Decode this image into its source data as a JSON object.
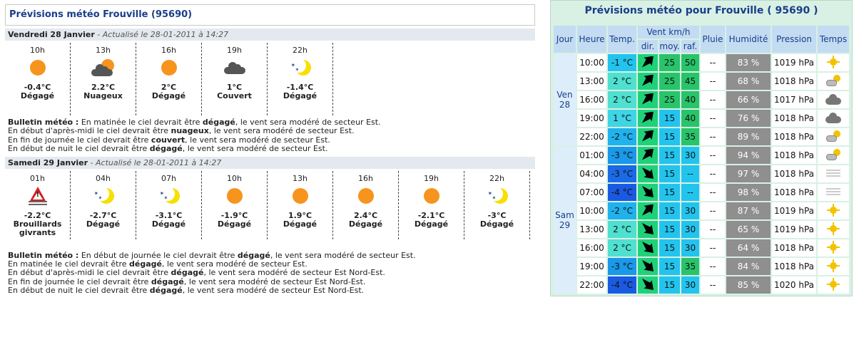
{
  "left": {
    "title": "Prévisions météo Frouville (95690)",
    "days": [
      {
        "name": "Vendredi 28 Janvier",
        "updated": "- Actualisé le 28-01-2011 à 14:27",
        "hours": [
          {
            "h": "10h",
            "icon": "sun-icon",
            "temp": "-0.4°C",
            "cond": "Dégagé"
          },
          {
            "h": "13h",
            "icon": "partly-cloudy-icon",
            "temp": "2.2°C",
            "cond": "Nuageux"
          },
          {
            "h": "16h",
            "icon": "sun-icon",
            "temp": "2°C",
            "cond": "Dégagé"
          },
          {
            "h": "19h",
            "icon": "cloud-icon",
            "temp": "1°C",
            "cond": "Couvert"
          },
          {
            "h": "22h",
            "icon": "moon-icon",
            "temp": "-1.4°C",
            "cond": "Dégagé"
          }
        ],
        "bulletin_label": "Bulletin météo :",
        "bulletin": [
          {
            "a": "En matinée le ciel devrait être ",
            "b": "dégagé",
            "c": ", le vent sera modéré de secteur Est."
          },
          {
            "a": "En début d'après-midi le ciel devrait être ",
            "b": "nuageux",
            "c": ", le vent sera modéré de secteur Est."
          },
          {
            "a": "En fin de journée le ciel devrait être ",
            "b": "couvert",
            "c": ", le vent sera modéré de secteur Est."
          },
          {
            "a": "En début de nuit le ciel devrait être ",
            "b": "dégagé",
            "c": ", le vent sera modéré de secteur Est."
          }
        ]
      },
      {
        "name": "Samedi 29 Janvier",
        "updated": "- Actualisé le 28-01-2011 à 14:27",
        "hours": [
          {
            "h": "01h",
            "icon": "fog-warning-icon",
            "temp": "-2.2°C",
            "cond": "Brouillards",
            "cond2": "givrants"
          },
          {
            "h": "04h",
            "icon": "moon-icon",
            "temp": "-2.7°C",
            "cond": "Dégagé"
          },
          {
            "h": "07h",
            "icon": "moon-icon",
            "temp": "-3.1°C",
            "cond": "Dégagé"
          },
          {
            "h": "10h",
            "icon": "sun-icon",
            "temp": "-1.9°C",
            "cond": "Dégagé"
          },
          {
            "h": "13h",
            "icon": "sun-icon",
            "temp": "1.9°C",
            "cond": "Dégagé"
          },
          {
            "h": "16h",
            "icon": "sun-icon",
            "temp": "2.4°C",
            "cond": "Dégagé"
          },
          {
            "h": "19h",
            "icon": "sun-icon",
            "temp": "-2.1°C",
            "cond": "Dégagé"
          },
          {
            "h": "22h",
            "icon": "moon-icon",
            "temp": "-3°C",
            "cond": "Dégagé"
          }
        ],
        "bulletin_label": "Bulletin météo :",
        "bulletin": [
          {
            "a": "En début de journée le ciel devrait être ",
            "b": "dégagé",
            "c": ", le vent sera modéré de secteur Est."
          },
          {
            "a": "En matinée le ciel devrait être ",
            "b": "dégagé",
            "c": ", le vent sera modéré de secteur Est."
          },
          {
            "a": "En début d'après-midi le ciel devrait être ",
            "b": "dégagé",
            "c": ", le vent sera modéré de secteur Est Nord-Est."
          },
          {
            "a": "En fin de journée le ciel devrait être ",
            "b": "dégagé",
            "c": ", le vent sera modéré de secteur Est Nord-Est."
          },
          {
            "a": "En début de nuit le ciel devrait être ",
            "b": "dégagé",
            "c": ", le vent sera modéré de secteur Est Nord-Est."
          }
        ]
      }
    ]
  },
  "right": {
    "title": "Prévisions météo pour Frouville ( 95690 )",
    "headers": {
      "jour": "Jour",
      "heure": "Heure",
      "temp": "Temp.",
      "vent": "Vent km/h",
      "dir": "dir.",
      "moy": "moy.",
      "raf": "raf.",
      "pluie": "Pluie",
      "humidite": "Humidité",
      "pression": "Pression",
      "temps": "Temps"
    },
    "groups": [
      {
        "day": "Ven",
        "date": "28",
        "rows": [
          {
            "heure": "10:00",
            "temp": "-1 °C",
            "temp_color": "#22c4ee",
            "dir": "arrow-ne",
            "moy": "25",
            "moy_color": "#28c46a",
            "raf": "50",
            "raf_color": "#28c46a",
            "pluie": "--",
            "hum": "83 %",
            "pres": "1019 hPa",
            "temps": "sun-icon"
          },
          {
            "heure": "13:00",
            "temp": "2 °C",
            "temp_color": "#4fe0d0",
            "dir": "arrow-ne",
            "moy": "25",
            "moy_color": "#28c46a",
            "raf": "45",
            "raf_color": "#28c46a",
            "pluie": "--",
            "hum": "68 %",
            "pres": "1018 hPa",
            "temps": "partly-cloudy-icon"
          },
          {
            "heure": "16:00",
            "temp": "2 °C",
            "temp_color": "#4fe0d0",
            "dir": "arrow-ne",
            "moy": "25",
            "moy_color": "#28c46a",
            "raf": "40",
            "raf_color": "#28c46a",
            "pluie": "--",
            "hum": "66 %",
            "pres": "1017 hPa",
            "temps": "cloud-icon"
          },
          {
            "heure": "19:00",
            "temp": "1 °C",
            "temp_color": "#3fd4e6",
            "dir": "arrow-ne",
            "moy": "15",
            "moy_color": "#22c4ee",
            "raf": "40",
            "raf_color": "#28c46a",
            "pluie": "--",
            "hum": "76 %",
            "pres": "1018 hPa",
            "temps": "cloud-icon"
          },
          {
            "heure": "22:00",
            "temp": "-2 °C",
            "temp_color": "#1fb2ec",
            "dir": "arrow-ne",
            "moy": "15",
            "moy_color": "#22c4ee",
            "raf": "35",
            "raf_color": "#28c46a",
            "pluie": "--",
            "hum": "89 %",
            "pres": "1018 hPa",
            "temps": "partly-cloudy-icon"
          }
        ]
      },
      {
        "day": "Sam",
        "date": "29",
        "rows": [
          {
            "heure": "01:00",
            "temp": "-3 °C",
            "temp_color": "#1a98ea",
            "dir": "arrow-ne",
            "moy": "15",
            "moy_color": "#22c4ee",
            "raf": "30",
            "raf_color": "#22c4ee",
            "pluie": "--",
            "hum": "94 %",
            "pres": "1018 hPa",
            "temps": "partly-cloudy-icon"
          },
          {
            "heure": "04:00",
            "temp": "-3 °C",
            "temp_color": "#1a6ae6",
            "dir": "arrow-se",
            "moy": "15",
            "moy_color": "#22c4ee",
            "raf": "--",
            "raf_color": "#22c4ee",
            "pluie": "--",
            "hum": "97 %",
            "pres": "1018 hPa",
            "temps": "fog-icon"
          },
          {
            "heure": "07:00",
            "temp": "-4 °C",
            "temp_color": "#1a5ae2",
            "dir": "arrow-se",
            "moy": "15",
            "moy_color": "#22c4ee",
            "raf": "--",
            "raf_color": "#22c4ee",
            "pluie": "--",
            "hum": "98 %",
            "pres": "1018 hPa",
            "temps": "fog-icon"
          },
          {
            "heure": "10:00",
            "temp": "-2 °C",
            "temp_color": "#1fb2ec",
            "dir": "arrow-ne",
            "moy": "15",
            "moy_color": "#22c4ee",
            "raf": "30",
            "raf_color": "#22c4ee",
            "pluie": "--",
            "hum": "87 %",
            "pres": "1019 hPa",
            "temps": "sun-icon"
          },
          {
            "heure": "13:00",
            "temp": "2 °C",
            "temp_color": "#4fe0d0",
            "dir": "arrow-se",
            "moy": "15",
            "moy_color": "#22c4ee",
            "raf": "30",
            "raf_color": "#22c4ee",
            "pluie": "--",
            "hum": "65 %",
            "pres": "1019 hPa",
            "temps": "sun-icon"
          },
          {
            "heure": "16:00",
            "temp": "2 °C",
            "temp_color": "#4fe0d0",
            "dir": "arrow-se",
            "moy": "15",
            "moy_color": "#22c4ee",
            "raf": "30",
            "raf_color": "#22c4ee",
            "pluie": "--",
            "hum": "64 %",
            "pres": "1018 hPa",
            "temps": "sun-icon"
          },
          {
            "heure": "19:00",
            "temp": "-3 °C",
            "temp_color": "#1a98ea",
            "dir": "arrow-se",
            "moy": "15",
            "moy_color": "#22c4ee",
            "raf": "35",
            "raf_color": "#28c46a",
            "pluie": "--",
            "hum": "84 %",
            "pres": "1018 hPa",
            "temps": "sun-icon"
          },
          {
            "heure": "22:00",
            "temp": "-4 °C",
            "temp_color": "#1a5ae2",
            "dir": "arrow-se",
            "moy": "15",
            "moy_color": "#22c4ee",
            "raf": "30",
            "raf_color": "#22c4ee",
            "pluie": "--",
            "hum": "85 %",
            "pres": "1020 hPa",
            "temps": "sun-icon"
          }
        ]
      }
    ]
  }
}
